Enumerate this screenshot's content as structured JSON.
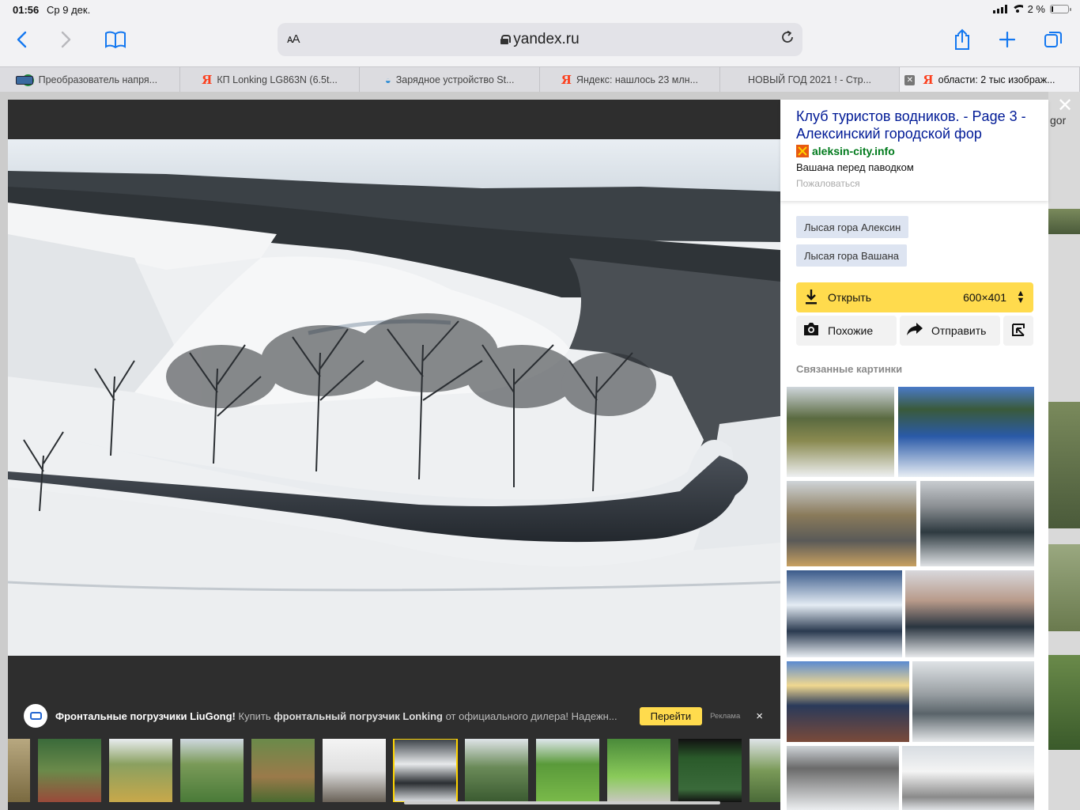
{
  "status": {
    "time": "01:56",
    "date": "Ср 9 дек.",
    "battery": "2 %"
  },
  "toolbar": {
    "aa_label": "AA",
    "url": "yandex.ru",
    "icons": [
      "back-icon",
      "forward-icon",
      "bookmarks-icon",
      "share-icon",
      "new-tab-icon",
      "tabs-icon",
      "reload-icon"
    ]
  },
  "tabs": [
    {
      "label": "Преобразователь напря...",
      "favicon": "metro"
    },
    {
      "label": "КП Lonking LG863N (6.5t...",
      "favicon": "yandex"
    },
    {
      "label": "Зарядное устройство St...",
      "favicon": "wave"
    },
    {
      "label": "Яндекс: нашлось 23 млн...",
      "favicon": "yandex"
    },
    {
      "label": "НОВЫЙ ГОД 2021 ! - Стр...",
      "favicon": "chip"
    },
    {
      "label": "области: 2 тыс изображ...",
      "favicon": "yandex"
    }
  ],
  "page_edge": {
    "text": "gor"
  },
  "ad": {
    "brand": "Фронтальные погрузчики LiuGong!",
    "text_before": "Купить",
    "highlight": "фронтальный погрузчик Lonking",
    "text_after": "от официального дилера! Надежн...",
    "button": "Перейти",
    "label": "Реклама",
    "close": "×"
  },
  "panel": {
    "title": "Клуб туристов водников. - Page 3 - Алексинский городской фор",
    "site": "aleksin-city.info",
    "description": "Вашана перед паводком",
    "report": "Пожаловаться",
    "tags": [
      "Лысая гора Алексин",
      "Лысая гора Вашана"
    ],
    "open_label": "Открыть",
    "size": "600×401",
    "similar_label": "Похожие",
    "send_label": "Отправить",
    "related_heading": "Связанные картинки"
  },
  "close_label": "✕"
}
